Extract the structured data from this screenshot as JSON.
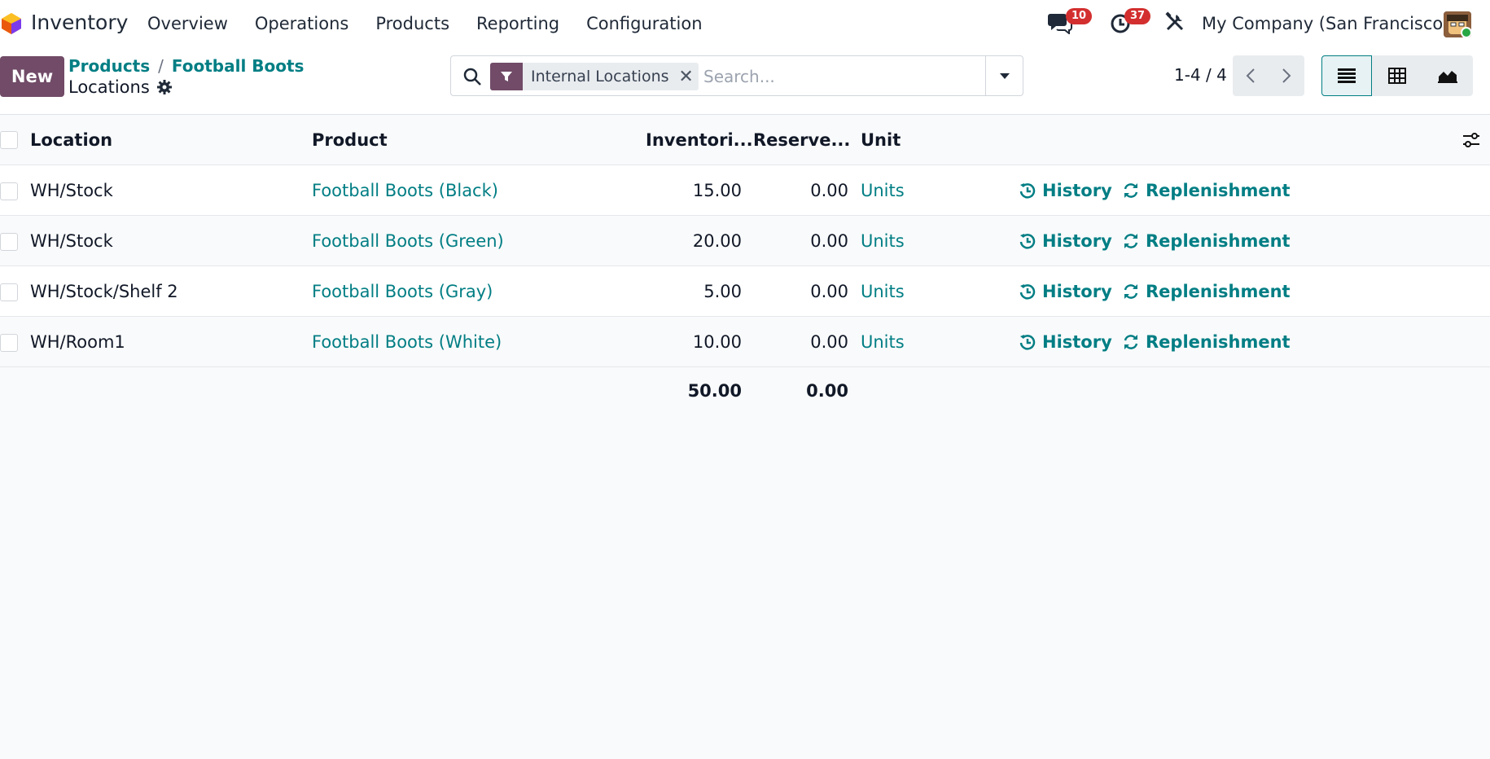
{
  "navbar": {
    "app_name": "Inventory",
    "menu": [
      "Overview",
      "Operations",
      "Products",
      "Reporting",
      "Configuration"
    ],
    "messages_count": "10",
    "activities_count": "37",
    "company": "My Company (San Francisco)"
  },
  "control": {
    "new_label": "New",
    "breadcrumb": [
      "Products",
      "Football Boots"
    ],
    "current": "Locations",
    "search": {
      "facet": "Internal Locations",
      "placeholder": "Search..."
    },
    "pager": "1-4 / 4"
  },
  "table": {
    "headers": {
      "location": "Location",
      "product": "Product",
      "inventoried": "Inventori...",
      "reserved": "Reserve...",
      "unit": "Unit"
    },
    "rows": [
      {
        "location": "WH/Stock",
        "product": "Football Boots (Black)",
        "inventoried": "15.00",
        "reserved": "0.00",
        "unit": "Units",
        "history": "History",
        "replenishment": "Replenishment"
      },
      {
        "location": "WH/Stock",
        "product": "Football Boots (Green)",
        "inventoried": "20.00",
        "reserved": "0.00",
        "unit": "Units",
        "history": "History",
        "replenishment": "Replenishment"
      },
      {
        "location": "WH/Stock/Shelf 2",
        "product": "Football Boots (Gray)",
        "inventoried": "5.00",
        "reserved": "0.00",
        "unit": "Units",
        "history": "History",
        "replenishment": "Replenishment"
      },
      {
        "location": "WH/Room1",
        "product": "Football Boots (White)",
        "inventoried": "10.00",
        "reserved": "0.00",
        "unit": "Units",
        "history": "History",
        "replenishment": "Replenishment"
      }
    ],
    "totals": {
      "inventoried": "50.00",
      "reserved": "0.00"
    }
  },
  "colors": {
    "brand": "#714b67",
    "link": "#017e84",
    "badge": "#d32f2f"
  }
}
